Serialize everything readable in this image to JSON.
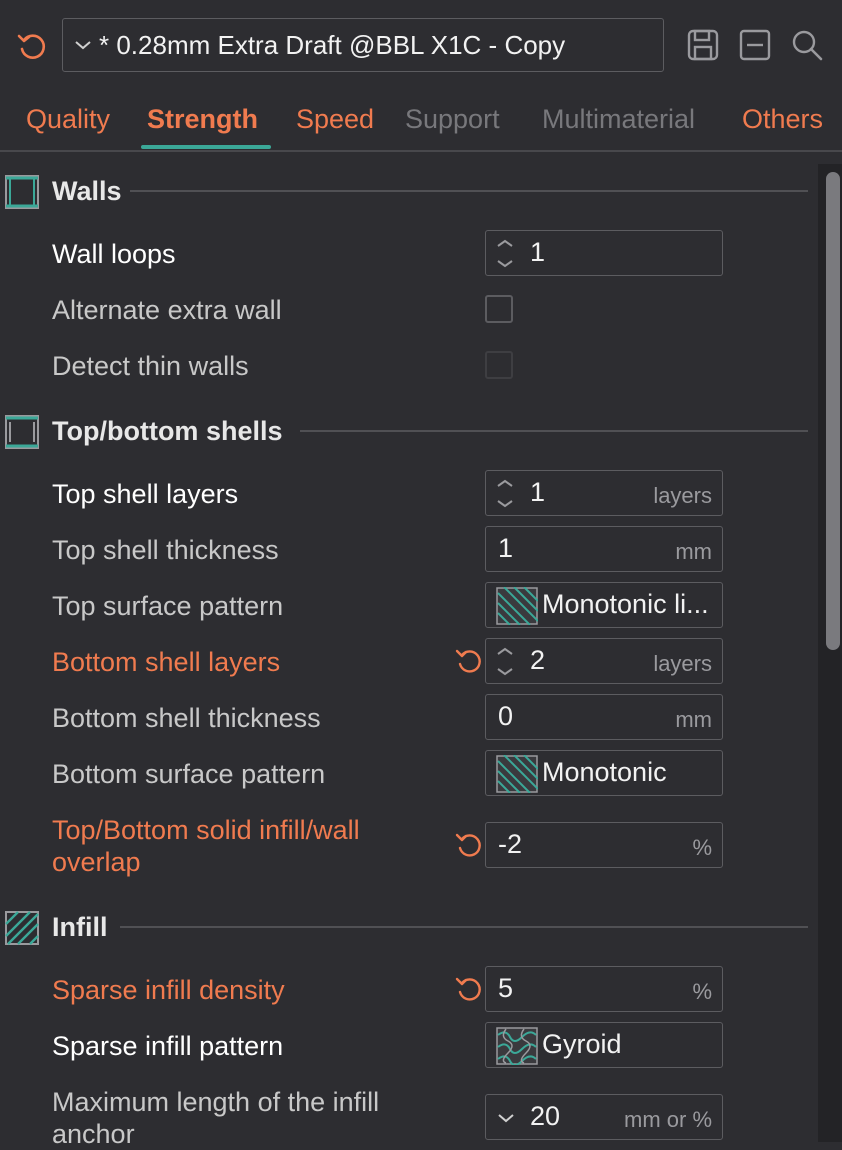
{
  "preset": {
    "name": "* 0.28mm Extra Draft @BBL X1C - Copy"
  },
  "icons": {
    "reset": "reset-icon",
    "save": "save-icon",
    "collapse": "collapse-icon",
    "search": "search-icon",
    "chevron": "chevron-down-icon"
  },
  "colors": {
    "accent": "#3ba898",
    "modified": "#f07b4f",
    "background": "#2d2d31"
  },
  "tabs": [
    {
      "label": "Quality"
    },
    {
      "label": "Strength"
    },
    {
      "label": "Speed"
    },
    {
      "label": "Support"
    },
    {
      "label": "Multimaterial"
    },
    {
      "label": "Others"
    }
  ],
  "sections": {
    "walls": {
      "title": "Walls",
      "wall_loops": {
        "label": "Wall loops",
        "value": "1"
      },
      "alternate_extra_wall": {
        "label": "Alternate extra wall",
        "checked": false
      },
      "detect_thin_walls": {
        "label": "Detect thin walls",
        "checked": false,
        "enabled": false
      }
    },
    "shells": {
      "title": "Top/bottom shells",
      "top_shell_layers": {
        "label": "Top shell layers",
        "value": "1",
        "unit": "layers"
      },
      "top_shell_thickness": {
        "label": "Top shell thickness",
        "value": "1",
        "unit": "mm"
      },
      "top_surface_pattern": {
        "label": "Top surface pattern",
        "value": "Monotonic li..."
      },
      "bottom_shell_layers": {
        "label": "Bottom shell layers",
        "value": "2",
        "unit": "layers"
      },
      "bottom_shell_thickness": {
        "label": "Bottom shell thickness",
        "value": "0",
        "unit": "mm"
      },
      "bottom_surface_pattern": {
        "label": "Bottom surface pattern",
        "value": "Monotonic"
      },
      "overlap": {
        "label_line1": "Top/Bottom solid infill/wall",
        "label_line2": "overlap",
        "value": "-2",
        "unit": "%"
      }
    },
    "infill": {
      "title": "Infill",
      "sparse_density": {
        "label": "Sparse infill density",
        "value": "5",
        "unit": "%"
      },
      "sparse_pattern": {
        "label": "Sparse infill pattern",
        "value": "Gyroid"
      },
      "anchor_max": {
        "label_line1": "Maximum length of the infill",
        "label_line2": "anchor",
        "value": "20",
        "unit": "mm or %"
      }
    }
  }
}
